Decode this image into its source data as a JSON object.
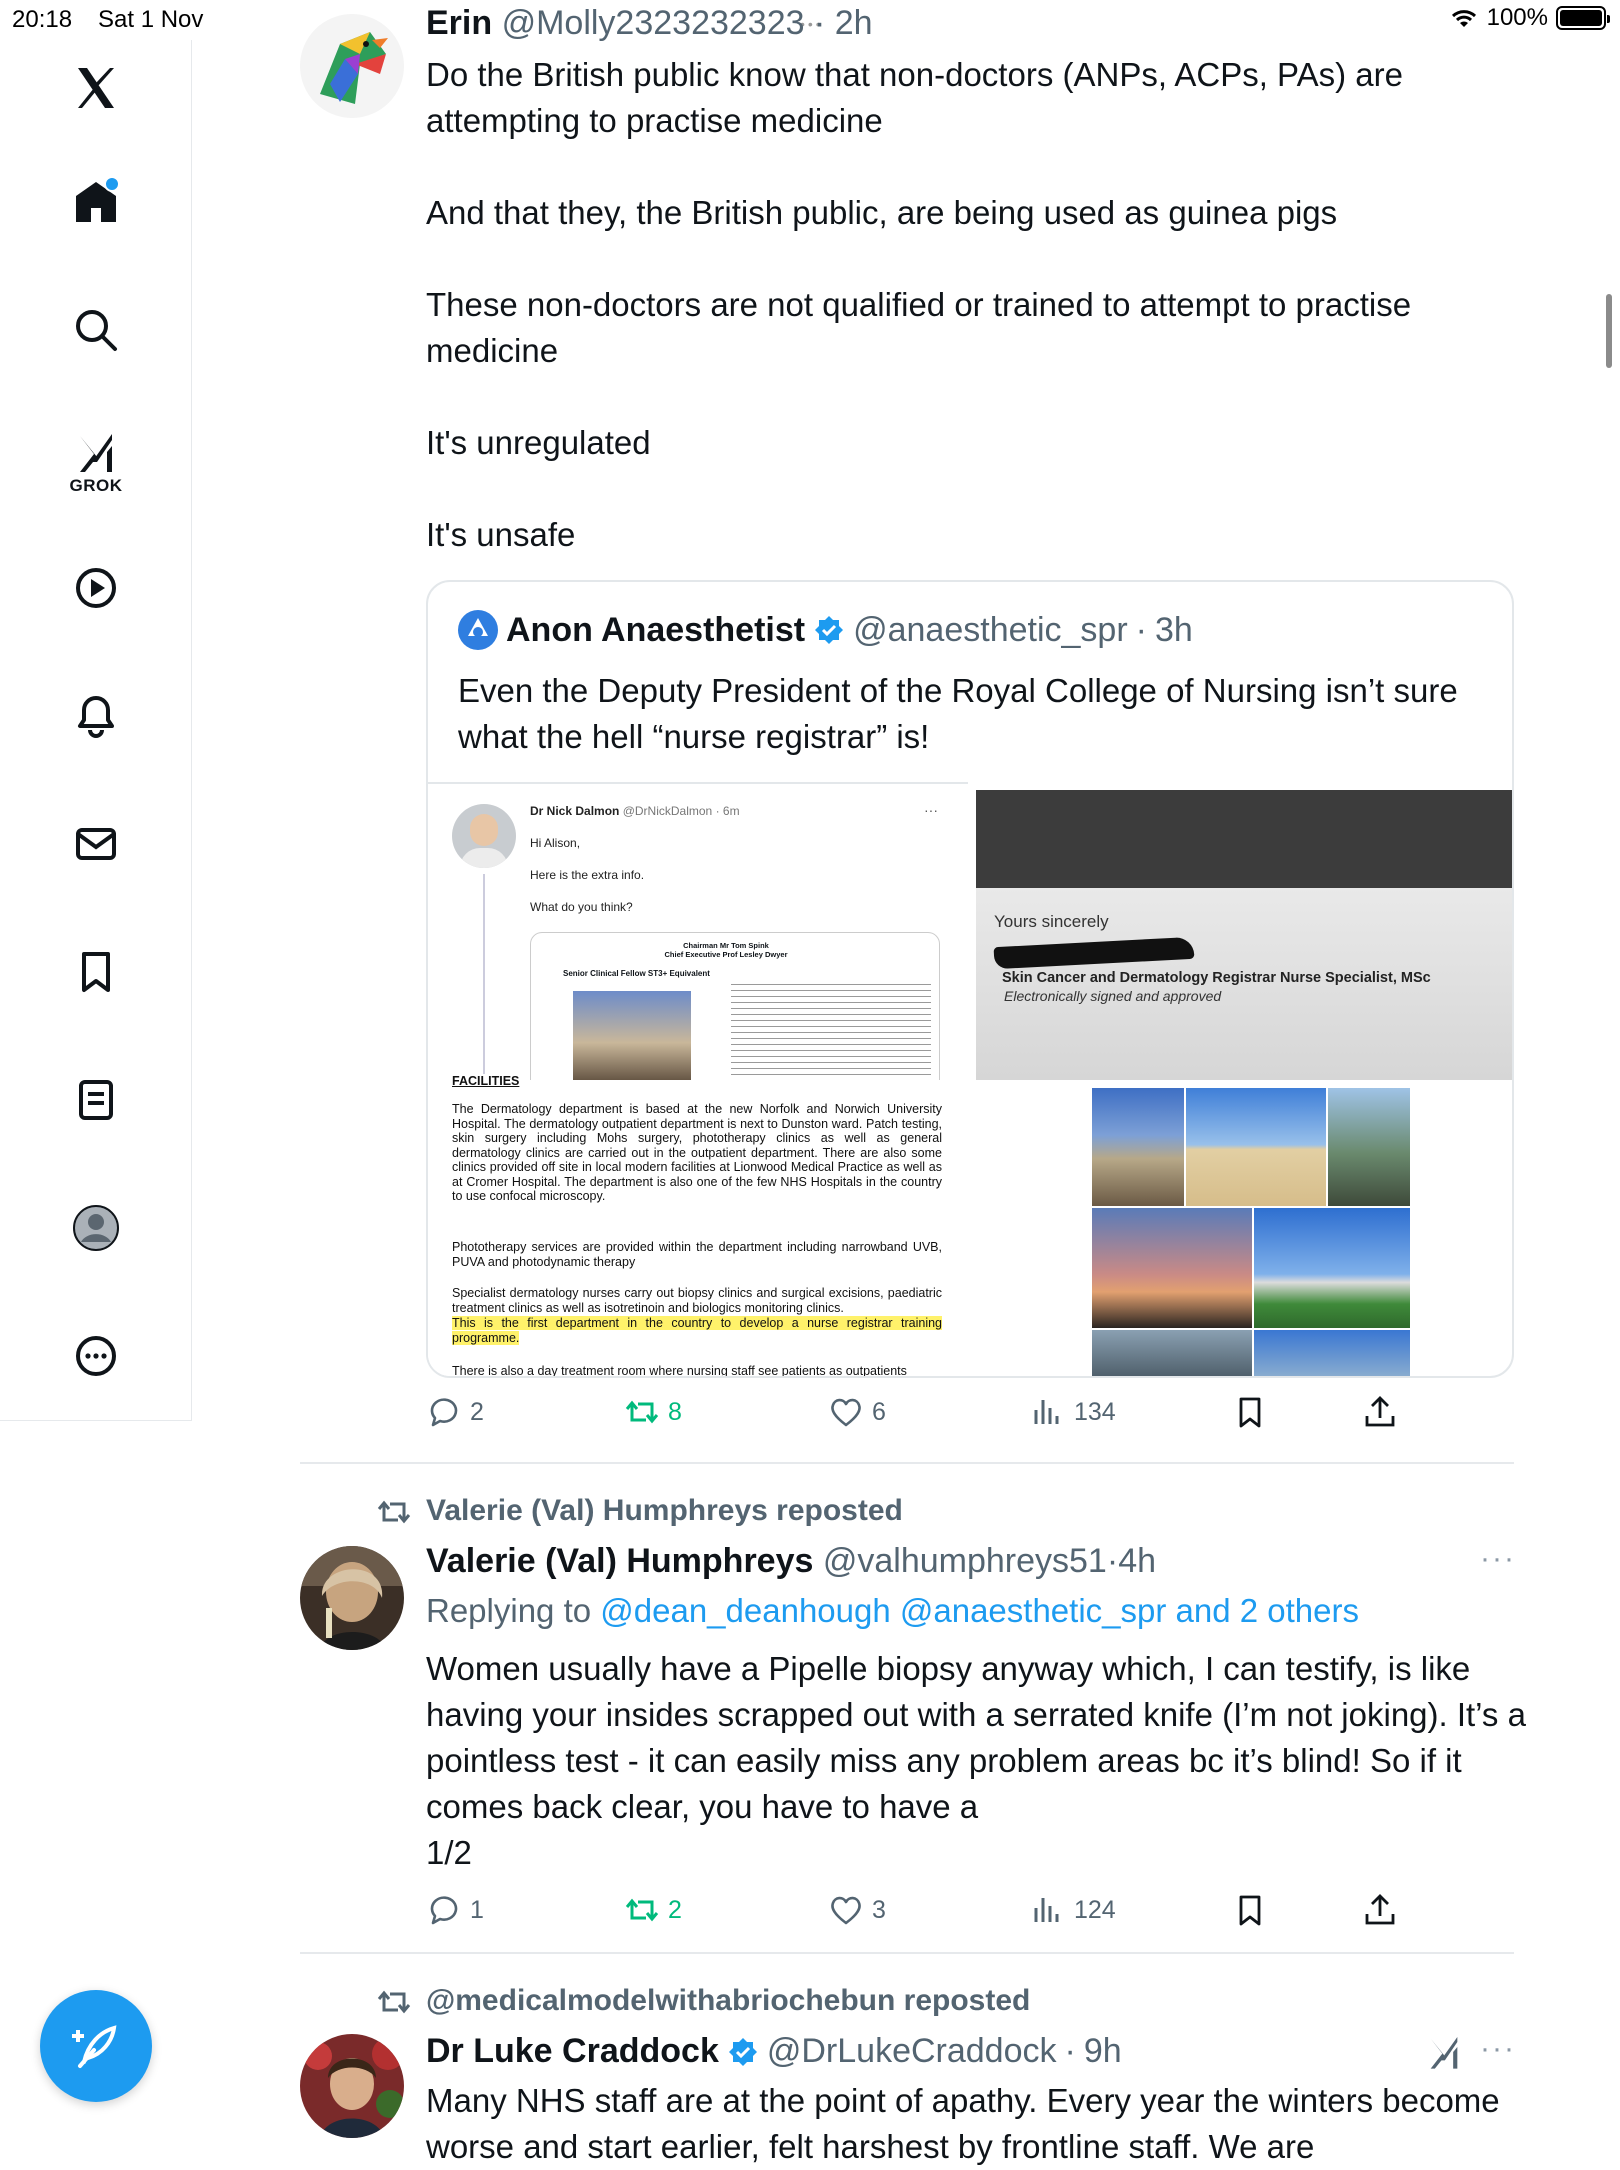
{
  "status_bar": {
    "time": "20:18",
    "date": "Sat 1 Nov",
    "battery": "100%"
  },
  "sidebar": {
    "items": [
      {
        "name": "x-logo-icon"
      },
      {
        "name": "home-icon",
        "has_notification": true
      },
      {
        "name": "search-icon"
      },
      {
        "name": "grok-icon",
        "label": "GROK"
      },
      {
        "name": "video-icon"
      },
      {
        "name": "notifications-icon"
      },
      {
        "name": "messages-icon"
      },
      {
        "name": "bookmarks-icon"
      },
      {
        "name": "lists-icon"
      },
      {
        "name": "profile-icon"
      },
      {
        "name": "more-icon"
      }
    ]
  },
  "colors": {
    "accent": "#1d9bf0",
    "text": "#0f1419",
    "muted": "#536471",
    "retweet": "#00ba7c"
  },
  "posts": [
    {
      "author": "Erin",
      "handle": "@Molly2323232323",
      "time": "2h",
      "paragraphs": [
        "Do the British public know that non-doctors (ANPs, ACPs, PAs) are attempting to practise medicine",
        "And that they, the British public, are being used as guinea pigs",
        "These non-doctors  are not qualified or trained to attempt to practise medicine",
        "It's unregulated",
        "It's unsafe"
      ],
      "quote": {
        "author": "Anon Anaesthetist",
        "handle": "@anaesthetic_spr",
        "time": "3h",
        "text": "Even the Deputy President of the Royal College of Nursing isn’t sure what the hell “nurse registrar” is!",
        "screenshot_left": {
          "author": "Dr Nick Dalmon",
          "handle": "@DrNickDalmon",
          "time": "6m",
          "lines": [
            "Hi Alison,",
            "Here is the extra info.",
            "What do you think?"
          ],
          "card_header": "Chairman Mr Tom Spink\nChief Executive Prof Lesley Dwyer",
          "card_role": "Senior Clinical Fellow ST3+ Equivalent",
          "doc_heading": "FACILITIES",
          "doc_para1": "The Dermatology department is based at the new Norfolk and Norwich University Hospital. The dermatology outpatient department is next to Dunston ward. Patch testing, skin surgery including Mohs surgery, phototherapy clinics as well as general dermatology clinics are carried out in the outpatient department. There are also some clinics provided off site in local modern facilities at Lionwood Medical Practice as well as at Cromer Hospital. The department is also one of the few NHS Hospitals in the country to use confocal microscopy.",
          "doc_para2": "Phototherapy services are provided within the department including narrowband UVB, PUVA and photodynamic therapy",
          "doc_para3": "Specialist dermatology nurses carry out biopsy clinics and surgical excisions, paediatric treatment clinics as well as isotretinoin and biologics monitoring clinics.",
          "doc_highlight": "This is the first department in the country to develop a nurse registrar training programme.",
          "doc_para4": "There is also a day treatment room where nursing staff see patients as outpatients"
        },
        "screenshot_right": {
          "closing": "Yours sincerely",
          "signature_title": "Skin Cancer and Dermatology Registrar Nurse Specialist, MSc",
          "signature_note": "Electronically signed and approved"
        }
      },
      "stats": {
        "replies": "2",
        "reposts": "8",
        "likes": "6",
        "views": "134"
      }
    },
    {
      "reposted_by": "Valerie (Val) Humphreys reposted",
      "author": "Valerie (Val) Humphreys",
      "handle": "@valhumphreys51",
      "time": "4h",
      "replying_prefix": "Replying to ",
      "replying_to": "@dean_deanhough @anaesthetic_spr and 2 others",
      "text": "Women usually have a Pipelle biopsy anyway which, I can testify, is like having your insides scrapped out with a serrated knife (I’m not joking). It’s a pointless test - it can easily miss any problem areas bc it’s blind! So if it comes back clear, you have to have a\n1/2",
      "stats": {
        "replies": "1",
        "reposts": "2",
        "likes": "3",
        "views": "124"
      }
    },
    {
      "reposted_by": "@medicalmodelwithabriochebun reposted",
      "author": "Dr Luke Craddock",
      "handle": "@DrLukeCraddock",
      "time": "9h",
      "text": "Many NHS staff are at the point of apathy. Every year the winters become worse and start earlier, felt harshest by frontline staff. We are"
    }
  ]
}
